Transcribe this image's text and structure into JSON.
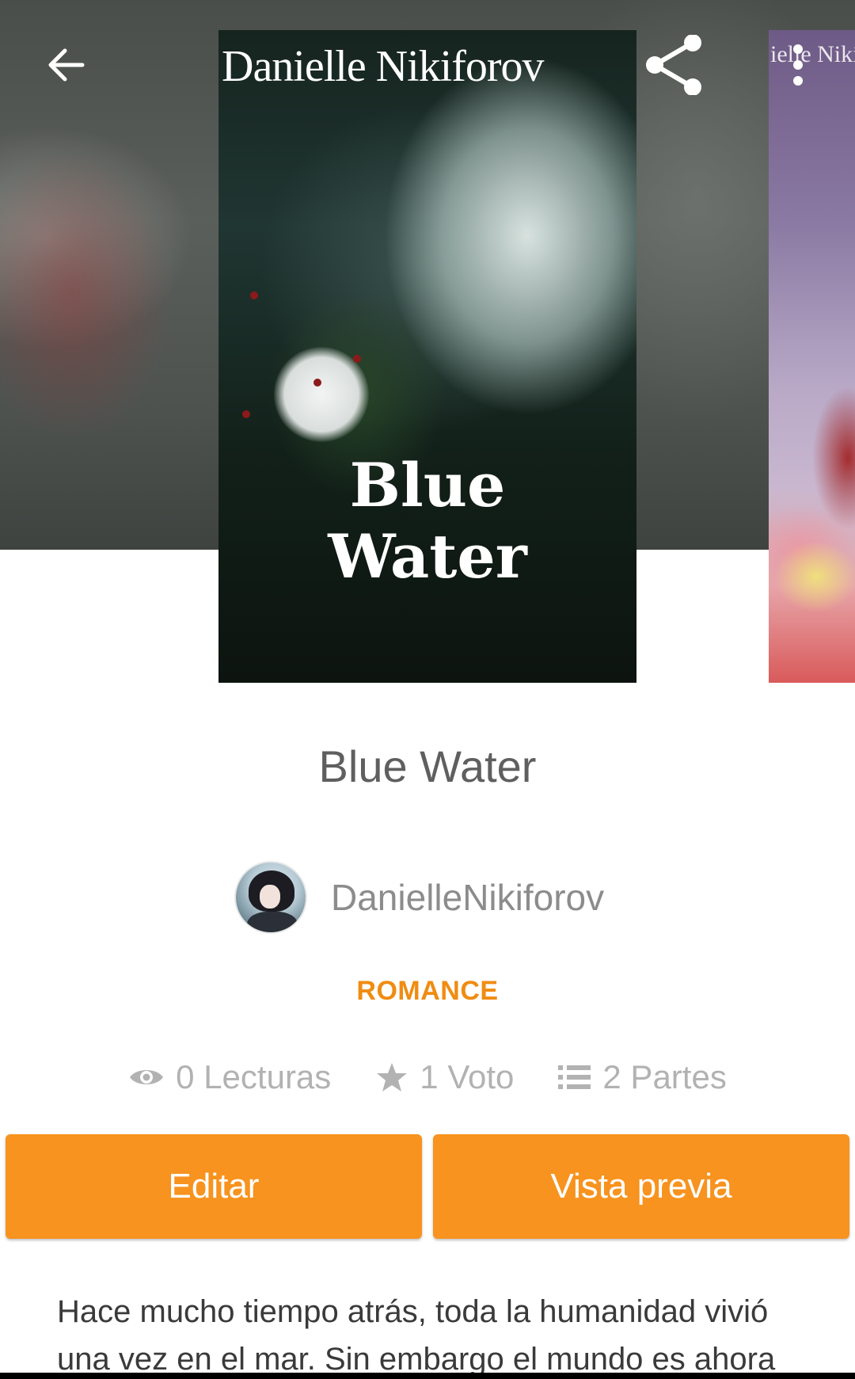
{
  "header": {
    "back_icon": "arrow-left-icon",
    "share_icon": "share-icon",
    "more_icon": "more-vertical-icon"
  },
  "cover": {
    "author_text": "Danielle Nikiforov",
    "title_line1": "Blue",
    "title_line2": "Water"
  },
  "next_cover": {
    "partial_text": "ielle Nikif"
  },
  "book": {
    "title": "Blue Water",
    "author": "DanielleNikiforov",
    "genre": "ROMANCE"
  },
  "stats": {
    "reads": "0 Lecturas",
    "votes": "1 Voto",
    "parts": "2 Partes"
  },
  "actions": {
    "edit_label": "Editar",
    "preview_label": "Vista previa"
  },
  "description": "Hace mucho tiempo atrás, toda la humanidad vivió una vez en el mar. Sin embargo el mundo es ahora",
  "colors": {
    "accent": "#f7931e",
    "genre": "#f08c12",
    "title_text": "#5f5f5f",
    "stat_text": "#b2b2b2"
  }
}
